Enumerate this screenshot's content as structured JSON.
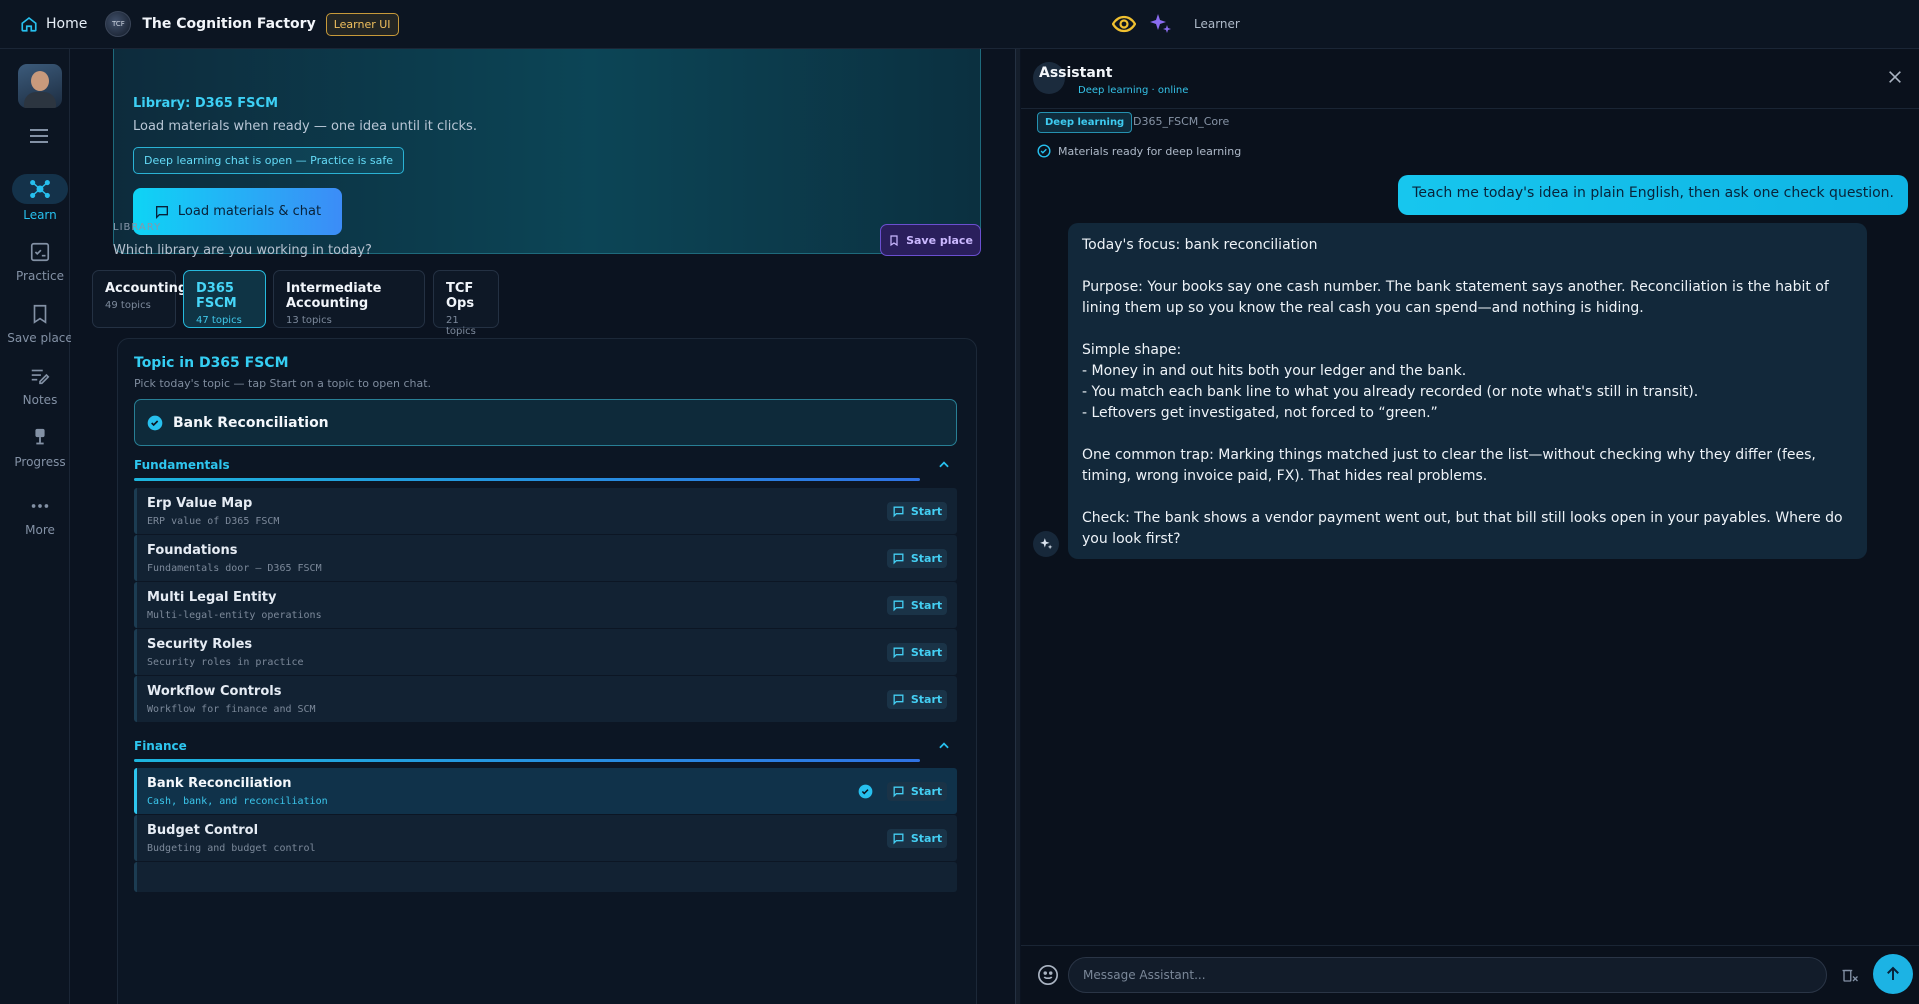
{
  "topbar": {
    "home_label": "Home",
    "brand_title": "The Cognition Factory",
    "brand_logo_text": "TCF",
    "badge": "Learner UI",
    "user_role": "Learner"
  },
  "rail": {
    "items": [
      {
        "label": "Learn",
        "icon": "network-icon"
      },
      {
        "label": "Practice",
        "icon": "checklist-icon"
      },
      {
        "label": "Save place",
        "icon": "bookmark-icon"
      },
      {
        "label": "Notes",
        "icon": "notes-icon"
      },
      {
        "label": "Progress",
        "icon": "trophy-icon"
      },
      {
        "label": "More",
        "icon": "more-icon"
      }
    ]
  },
  "hero": {
    "library_label": "Library: D365 FSCM",
    "subtitle": "Load materials when ready — one idea until it clicks.",
    "chip": "Deep learning chat is open — Practice is safe",
    "load_button": "Load materials & chat"
  },
  "library": {
    "section_label": "LIBRARY",
    "question": "Which library are you working in today?",
    "save_place": "Save place",
    "cards": [
      {
        "name": "Accounting",
        "count": "49 topics"
      },
      {
        "name": "D365 FSCM",
        "count": "47 topics"
      },
      {
        "name": "Intermediate Accounting",
        "count": "13 topics"
      },
      {
        "name": "TCF Ops",
        "count": "21 topics"
      }
    ]
  },
  "topics": {
    "title": "Topic in D365 FSCM",
    "hint": "Pick today's topic — tap Start on a topic to open chat.",
    "selected": "Bank Reconciliation",
    "start_label": "Start",
    "groups": [
      {
        "name": "Fundamentals",
        "rows": [
          {
            "name": "Erp Value Map",
            "desc": "ERP value of D365 FSCM"
          },
          {
            "name": "Foundations",
            "desc": "Fundamentals door — D365 FSCM"
          },
          {
            "name": "Multi Legal Entity",
            "desc": "Multi-legal-entity operations"
          },
          {
            "name": "Security Roles",
            "desc": "Security roles in practice"
          },
          {
            "name": "Workflow Controls",
            "desc": "Workflow for finance and SCM"
          }
        ]
      },
      {
        "name": "Finance",
        "rows": [
          {
            "name": "Bank Reconciliation",
            "desc": "Cash, bank, and reconciliation"
          },
          {
            "name": "Budget Control",
            "desc": "Budgeting and budget control"
          }
        ]
      }
    ]
  },
  "chat": {
    "title": "Assistant",
    "status": "Deep learning · online",
    "mode_chip": "Deep learning",
    "library_id": "D365_FSCM_Core",
    "ready": "Materials ready for deep learning",
    "user_message": "Teach me today's idea in plain English, then ask one check question.",
    "bot_message": {
      "focus": "Today's focus: bank reconciliation",
      "purpose": "Purpose: Your books say one cash number. The bank statement says another. Reconciliation is the habit of lining them up so you know the real cash you can spend—and nothing is hiding.",
      "shape_title": "Simple shape:",
      "shape_1": "- Money in and out hits both your ledger and the bank.",
      "shape_2": "- You match each bank line to what you already recorded (or note what's still in transit).",
      "shape_3": "- Leftovers get investigated, not forced to “green.”",
      "trap": "One common trap: Marking things matched just to clear the list—without checking why they differ (fees, timing, wrong invoice paid, FX). That hides real problems.",
      "check": "Check: The bank shows a vendor payment went out, but that bill still looks open in your payables. Where do you look first?"
    },
    "input_placeholder": "Message Assistant..."
  },
  "colors": {
    "accent": "#27c0ee",
    "learner_badge": "#f0c05e",
    "save_place": "#6b4fd0"
  }
}
